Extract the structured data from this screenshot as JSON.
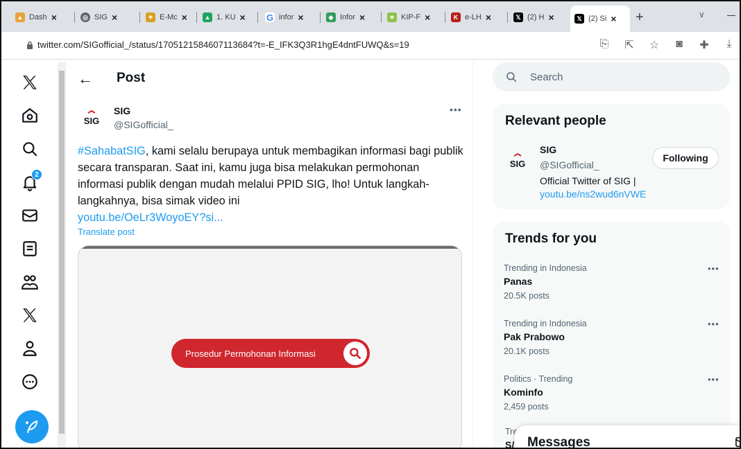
{
  "browser": {
    "tabs": [
      {
        "label": "Dash",
        "icon": "dashboard-icon"
      },
      {
        "label": "SIG",
        "icon": "chrome-icon"
      },
      {
        "label": "E-Mc",
        "icon": "garuda-icon"
      },
      {
        "label": "1. KU",
        "icon": "drive-icon"
      },
      {
        "label": "infor",
        "icon": "google-icon"
      },
      {
        "label": "Infor",
        "icon": "ppid-icon"
      },
      {
        "label": "KIP-F",
        "icon": "kip-icon"
      },
      {
        "label": "e-LH",
        "icon": "kpk-icon"
      },
      {
        "label": "(2) H",
        "icon": "x-logo-icon"
      },
      {
        "label": "(2) Si",
        "icon": "x-logo-icon"
      }
    ],
    "url": "twitter.com/SIGofficial_/status/1705121584607113684?t=-E_IFK3Q3R1hgE4dntFUWQ&s=19"
  },
  "nav": {
    "notifications_badge": "2"
  },
  "post": {
    "header_title": "Post",
    "author_name": "SIG",
    "author_handle": "@SIGofficial_",
    "hashtag": "#SahabatSIG",
    "text": ", kami selalu berupaya untuk membagikan informasi bagi publik secara transparan. Saat ini, kamu juga bisa melakukan permohonan informasi publik dengan mudah melalui PPID SIG, lho! Untuk langkah-langkahnya, bisa simak video ini",
    "link": "youtu.be/OeLr3WoyoEY?si...",
    "translate": "Translate post",
    "media_label": "Prosedur Permohonan Informasi",
    "logo_text": "SIG"
  },
  "search": {
    "placeholder": "Search"
  },
  "relevant_people": {
    "title": "Relevant people",
    "name": "SIG",
    "handle": "@SIGofficial_",
    "bio": "Official Twitter of SIG |",
    "bio_link": "youtu.be/ns2wud6nVWE",
    "follow_label": "Following"
  },
  "trends": {
    "title": "Trends for you",
    "items": [
      {
        "category": "Trending in Indonesia",
        "name": "Panas",
        "count": "20.5K posts"
      },
      {
        "category": "Trending in Indonesia",
        "name": "Pak Prabowo",
        "count": "20.1K posts"
      },
      {
        "category": "Politics · Trending",
        "name": "Kominfo",
        "count": "2,459 posts"
      }
    ],
    "partial_category": "Tre",
    "partial_name": "S/"
  },
  "messages": {
    "title": "Messages"
  },
  "colors": {
    "accent": "#1d9bf0",
    "media_button": "#d0262e",
    "tabbar": "#dee1e6"
  }
}
